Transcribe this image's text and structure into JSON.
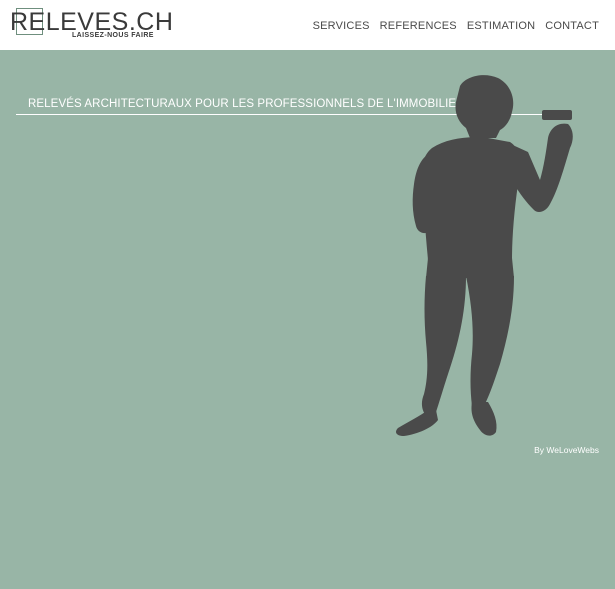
{
  "logo": {
    "title": "RELEVES.CH",
    "tagline": "LAISSEZ-NOUS FAIRE"
  },
  "nav": {
    "items": [
      "SERVICES",
      "REFERENCES",
      "ESTIMATION",
      "CONTACT"
    ]
  },
  "hero": {
    "tagline": "RELEVÉS ARCHITECTURAUX POUR LES PROFESSIONNELS DE L'IMMOBILIER"
  },
  "footer": {
    "credit": "By WeLoveWebs"
  },
  "colors": {
    "background": "#98b5a6",
    "header": "#ffffff",
    "silhouette": "#4a4a4a",
    "text_light": "#ffffff",
    "text_dark": "#4a4a4a"
  },
  "icons": {
    "silhouette": "person-measuring-silhouette"
  }
}
